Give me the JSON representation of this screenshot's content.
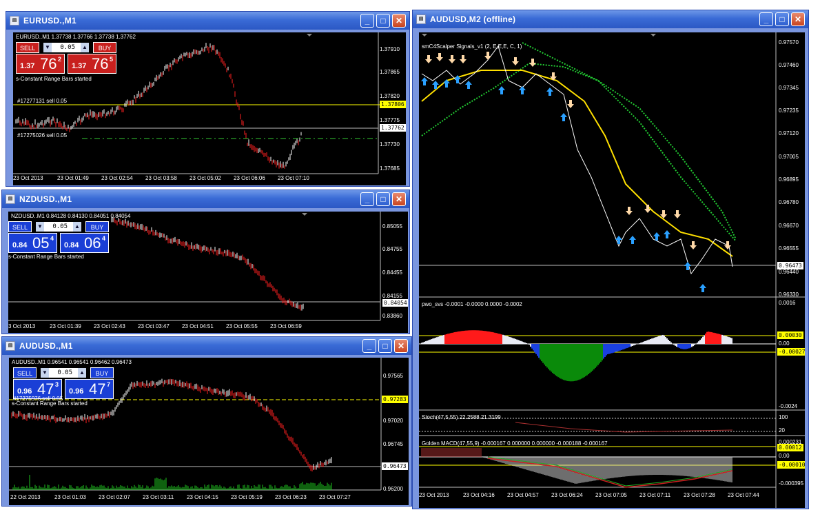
{
  "windows": {
    "eurusd": {
      "title": "EURUSD.,M1",
      "symbol_line": "EURUSD..M1  1.37738 1.37766 1.37738 1.37762",
      "trade_panel": {
        "sell_label": "SELL",
        "buy_label": "BUY",
        "lot": "0.05",
        "sell_small": "1.37",
        "sell_big": "76",
        "sell_sup": "2",
        "buy_small": "1.37",
        "buy_big": "76",
        "buy_sup": "5"
      },
      "status": "s-Constant Range Bars started",
      "order1": "#17277131 sell 0.05",
      "order2": "#17275026 sell 0.05",
      "price_labels": [
        "1.37910",
        "1.37865",
        "1.37820",
        "1.37775",
        "1.37730",
        "1.37685"
      ],
      "tag_yellow": "1.37806",
      "tag_white": "1.37762",
      "time_labels": [
        "23 Oct 2013",
        "23 Oct 01:49",
        "23 Oct 02:54",
        "23 Oct 03:58",
        "23 Oct 05:02",
        "23 Oct 06:06",
        "23 Oct 07:10"
      ]
    },
    "nzdusd": {
      "title": "NZDUSD.,M1",
      "symbol_line": "NZDUSD..M1  0.84128 0.84130 0.84051 0.84054",
      "trade_panel": {
        "sell_label": "SELL",
        "buy_label": "BUY",
        "lot": "0.05",
        "sell_small": "0.84",
        "sell_big": "05",
        "sell_sup": "4",
        "buy_small": "0.84",
        "buy_big": "06",
        "buy_sup": "4"
      },
      "status": "s-Constant Range Bars started",
      "price_labels": [
        "0.85055",
        "0.84755",
        "0.84455",
        "0.84155",
        "0.83860"
      ],
      "tag_white": "0.84054",
      "time_labels": [
        "3 Oct 2013",
        "23 Oct 01:39",
        "23 Oct 02:43",
        "23 Oct 03:47",
        "23 Oct 04:51",
        "23 Oct 05:55",
        "23 Oct 06:59"
      ]
    },
    "audusd_m1": {
      "title": "AUDUSD.,M1",
      "symbol_line": "AUDUSD..M1  0.96541 0.96541 0.96462 0.96473",
      "trade_panel": {
        "sell_label": "SELL",
        "buy_label": "BUY",
        "lot": "0.05",
        "sell_small": "0.96",
        "sell_big": "47",
        "sell_sup": "3",
        "buy_small": "0.96",
        "buy_big": "47",
        "buy_sup": "7"
      },
      "status": "s-Constant Range Bars started",
      "order1": "#17275976 sell 0.05",
      "price_labels": [
        "0.97565",
        "0.97283",
        "0.97020",
        "0.96745",
        "0.96473",
        "0.96200"
      ],
      "tag_yellow": "0.97283",
      "tag_white": "0.96473",
      "time_labels": [
        "22 Oct 2013",
        "23 Oct 01:03",
        "23 Oct 02:07",
        "23 Oct 03:11",
        "23 Oct 04:15",
        "23 Oct 05:19",
        "23 Oct 06:23",
        "23 Oct 07:27"
      ]
    },
    "audusd_m2": {
      "title": "AUDUSD,M2 (offline)",
      "indicator_label": "smC4Scalper Signals_v1 (2, E,E,E, C, 1)",
      "price_labels": [
        "0.97570",
        "0.97460",
        "0.97345",
        "0.97235",
        "0.97120",
        "0.97005",
        "0.96895",
        "0.96780",
        "0.96670",
        "0.96555",
        "0.96440",
        "0.96330"
      ],
      "tag_white": "0.96473",
      "pwo": {
        "label": "pwo_svs -0.0001 -0.0000 0.0000 -0.0002",
        "levels": [
          "0.0016",
          "0.00030",
          "0.00",
          "-0.00027",
          "-0.0024"
        ]
      },
      "stoch": {
        "label": "Stoch(47,5,55) 22.2588 21.3199",
        "levels": [
          "100",
          "20"
        ]
      },
      "macd": {
        "label": "Golden MACD(47,55,9) -0.000167 0.000000 0.000000 -0.000188 -0.000167",
        "levels": [
          "0.000231",
          "0.00012",
          "0.00",
          "-0.00010",
          "-0.000395"
        ]
      },
      "time_labels": [
        "23 Oct 2013",
        "23 Oct 04:16",
        "23 Oct 04:57",
        "23 Oct 06:24",
        "23 Oct 07:05",
        "23 Oct 07:11",
        "23 Oct 07:28",
        "23 Oct 07:44"
      ]
    }
  },
  "colors": {
    "bull": "#ffffff",
    "bear": "#ff2020",
    "yellow": "#ffff00",
    "green_dash": "#33cc33",
    "ma_yellow": "#ffe000",
    "ma_green": "#22cc33",
    "arrow_up": "#2aa0ff",
    "arrow_down": "#ffd9a8"
  },
  "icons": {
    "minimize": "minimize-icon",
    "maximize": "maximize-icon",
    "close": "close-icon"
  }
}
